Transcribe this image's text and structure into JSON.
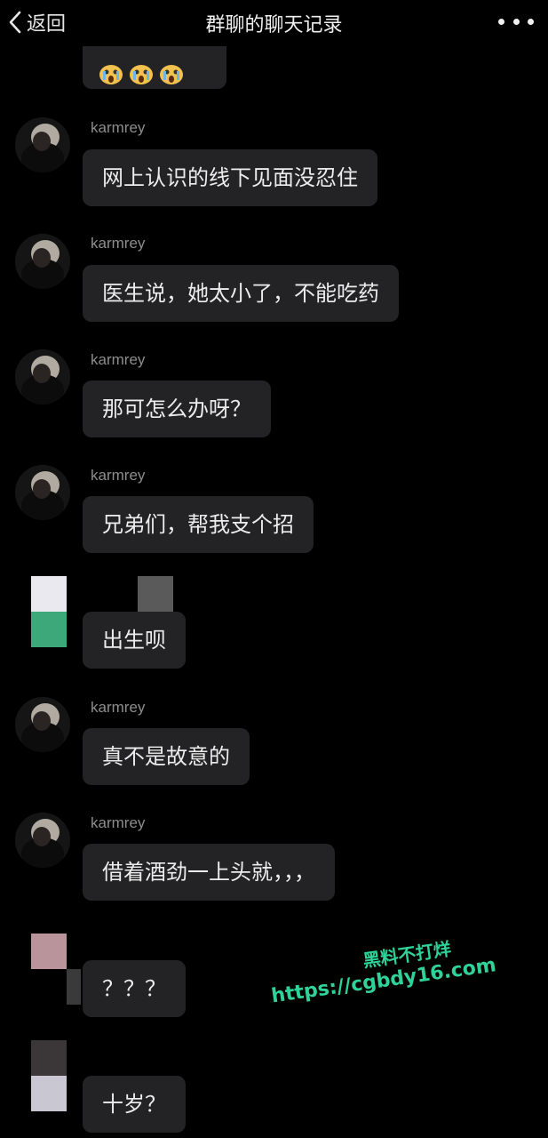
{
  "header": {
    "back_label": "返回",
    "title": "群聊的聊天记录"
  },
  "messages": [
    {
      "sender": "karmrey",
      "text": "网上认识的线下见面没忍住"
    },
    {
      "sender": "karmrey",
      "text": "医生说，她太小了，不能吃药"
    },
    {
      "sender": "karmrey",
      "text": "那可怎么办呀？"
    },
    {
      "sender": "karmrey",
      "text": "兄弟们，帮我支个招"
    },
    {
      "sender": "",
      "text": "出生呗"
    },
    {
      "sender": "karmrey",
      "text": "真不是故意的"
    },
    {
      "sender": "karmrey",
      "text": "借着酒劲一上头就，，，"
    },
    {
      "sender": "",
      "text": "？？？"
    },
    {
      "sender": "",
      "text": "十岁？"
    }
  ],
  "watermark": {
    "line1": "黑料不打烊",
    "line2": "https://cgbdy16.com"
  },
  "colors": {
    "background": "#000000",
    "bubble": "#232325",
    "watermark": "#2fd39a"
  }
}
